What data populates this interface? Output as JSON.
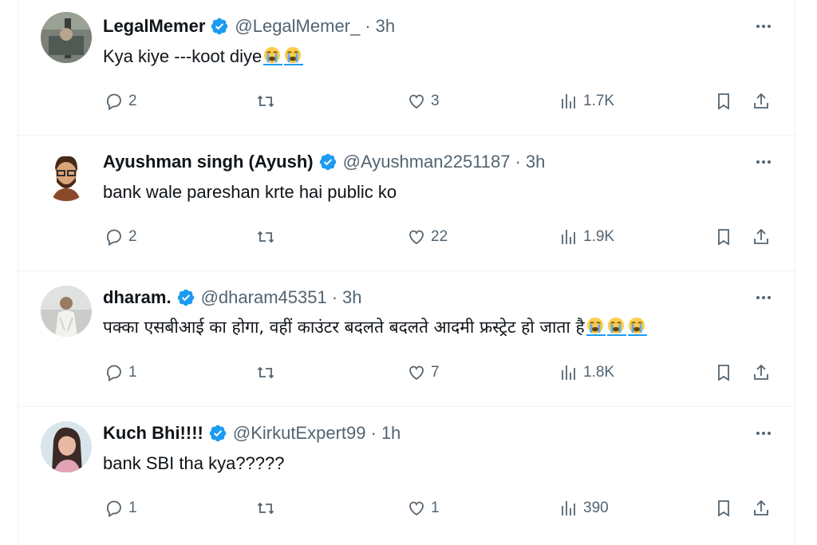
{
  "tweets": [
    {
      "name": "LegalMemer",
      "handle": "@LegalMemer_",
      "dot": "·",
      "time": "3h",
      "text": "Kya kiye ---koot diye",
      "emoji_count": 2,
      "replies": "2",
      "likes": "3",
      "views": "1.7K"
    },
    {
      "name": "Ayushman singh (Ayush)",
      "handle": "@Ayushman2251187",
      "dot": "·",
      "time": "3h",
      "text": "bank wale pareshan krte hai public ko",
      "emoji_count": 0,
      "replies": "2",
      "likes": "22",
      "views": "1.9K"
    },
    {
      "name": "dharam.",
      "handle": "@dharam45351",
      "dot": "·",
      "time": "3h",
      "text": "पक्का एसबीआई का होगा, वहीं काउंटर बदलते बदलते आदमी फ्रस्ट्रेट हो जाता है",
      "emoji_count": 3,
      "replies": "1",
      "likes": "7",
      "views": "1.8K"
    },
    {
      "name": "Kuch Bhi!!!!",
      "handle": "@KirkutExpert99",
      "dot": "·",
      "time": "1h",
      "text": "bank SBI tha kya?????",
      "emoji_count": 0,
      "replies": "1",
      "likes": "1",
      "views": "390"
    }
  ],
  "icons": {
    "verified": "verified-badge-icon",
    "more": "more-horizontal-icon",
    "reply": "reply-icon",
    "retweet": "retweet-icon",
    "like": "heart-icon",
    "views": "views-chart-icon",
    "bookmark": "bookmark-icon",
    "share": "share-icon",
    "emoji": "loudly-crying-face-emoji"
  },
  "colors": {
    "verified": "#1d9bf0",
    "text": "#0f1419",
    "secondary": "#536471",
    "divider": "#eff3f4"
  }
}
